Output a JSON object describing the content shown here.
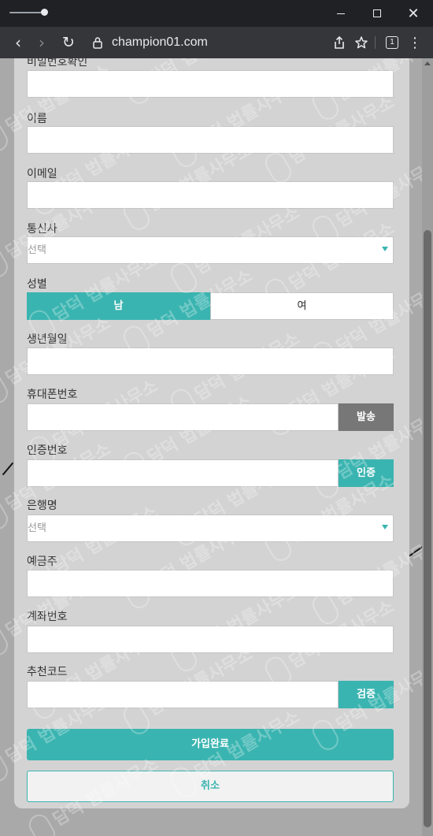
{
  "browser": {
    "url": "champion01.com",
    "tab_count": "1"
  },
  "watermark": "담덕 법률사무소",
  "form": {
    "password_confirm_label": "비밀번호확인",
    "name_label": "이름",
    "email_label": "이메일",
    "carrier_label": "통신사",
    "carrier_value": "선택",
    "gender_label": "성별",
    "gender_male": "남",
    "gender_female": "여",
    "gender_selected": "남",
    "birth_label": "생년월일",
    "phone_label": "휴대폰번호",
    "send_button": "발송",
    "auth_code_label": "인증번호",
    "verify_button": "인증",
    "bank_label": "은행명",
    "bank_value": "선택",
    "depositor_label": "예금주",
    "account_label": "계좌번호",
    "referral_label": "추천코드",
    "check_button": "검증",
    "submit_button": "가입완료",
    "cancel_button": "취소"
  }
}
